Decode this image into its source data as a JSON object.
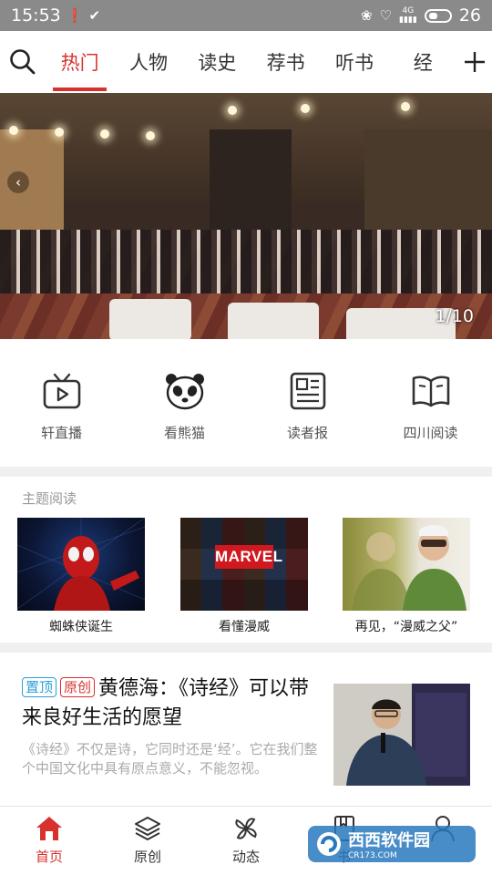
{
  "status_bar": {
    "time": "15:53",
    "network": "4G",
    "battery_level": "26"
  },
  "top_tabs": [
    {
      "label": "热门",
      "active": true
    },
    {
      "label": "人物"
    },
    {
      "label": "读史"
    },
    {
      "label": "荐书"
    },
    {
      "label": "听书"
    },
    {
      "label": "经"
    }
  ],
  "banner": {
    "counter": "1/10"
  },
  "quick_links": [
    {
      "label": "轩直播",
      "icon": "tv-icon"
    },
    {
      "label": "看熊猫",
      "icon": "panda-icon"
    },
    {
      "label": "读者报",
      "icon": "newspaper-icon"
    },
    {
      "label": "四川阅读",
      "icon": "book-icon"
    }
  ],
  "theme_section": {
    "title": "主题阅读",
    "cards": [
      {
        "caption": "蜘蛛侠诞生"
      },
      {
        "caption": "看懂漫威",
        "poster_text": "MARVEL"
      },
      {
        "caption": "再见，“漫威之父”"
      }
    ]
  },
  "article": {
    "tag_top": "置顶",
    "tag_original": "原创",
    "title": "黄德海：《诗经》可以带来良好生活的愿望",
    "summary": "《诗经》不仅是诗，它同时还是‘经’。它在我们整个中国文化中具有原点意义，不能忽视。"
  },
  "bottom_nav": [
    {
      "label": "首页",
      "icon": "home-icon",
      "active": true
    },
    {
      "label": "原创",
      "icon": "layers-icon"
    },
    {
      "label": "动态",
      "icon": "pinwheel-icon"
    },
    {
      "label": "书",
      "icon": "bookmark-icon"
    },
    {
      "label": "",
      "icon": "user-icon"
    }
  ],
  "watermark": {
    "text": "西西软件园",
    "url_text": "CR173.COM"
  },
  "colors": {
    "accent": "#d8322e",
    "tag_blue": "#2b9fd8",
    "status_bar": "#8a8a8a"
  }
}
